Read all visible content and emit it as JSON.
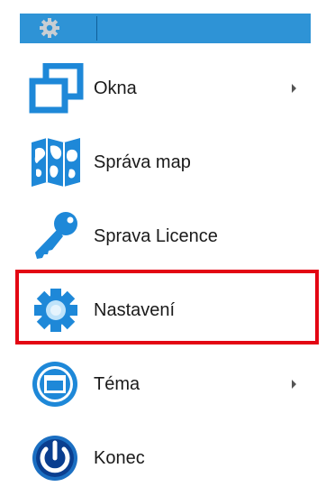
{
  "header": {
    "icon": "gear-icon",
    "background_color": "#2e93d6"
  },
  "menu": {
    "items": [
      {
        "label": "Okna",
        "icon": "windows-icon",
        "has_submenu": true
      },
      {
        "label": "Správa map",
        "icon": "map-icon",
        "has_submenu": false
      },
      {
        "label": "Sprava Licence",
        "icon": "key-icon",
        "has_submenu": false
      },
      {
        "label": "Nastavení",
        "icon": "settings-gear-icon",
        "has_submenu": false,
        "highlighted": true
      },
      {
        "label": "Téma",
        "icon": "theme-icon",
        "has_submenu": true
      },
      {
        "label": "Konec",
        "icon": "power-icon",
        "has_submenu": false
      }
    ]
  },
  "highlight_color": "#e30613"
}
